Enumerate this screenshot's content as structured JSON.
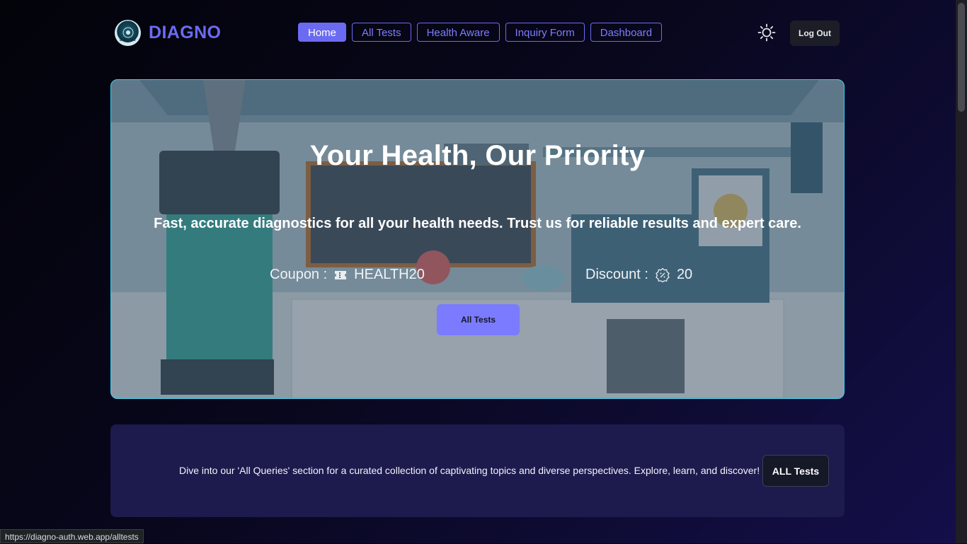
{
  "brand": {
    "name": "DIAGNO",
    "badge_text": "DIAG.NO"
  },
  "nav": {
    "items": [
      {
        "label": "Home",
        "active": true
      },
      {
        "label": "All Tests",
        "active": false
      },
      {
        "label": "Health Aware",
        "active": false
      },
      {
        "label": "Inquiry Form",
        "active": false
      },
      {
        "label": "Dashboard",
        "active": false
      }
    ]
  },
  "header": {
    "theme_icon": "sun-icon",
    "logout_label": "Log Out"
  },
  "hero": {
    "title": "Your Health, Our Priority",
    "subtitle": "Fast, accurate diagnostics for all your health needs. Trust us for reliable results and expert care.",
    "coupon_label": "Coupon :",
    "coupon_icon": "ticket-icon",
    "coupon_code": "HEALTH20",
    "discount_label": "Discount :",
    "discount_icon": "badge-percent-icon",
    "discount_value": "20",
    "button_label": "All Tests"
  },
  "banner": {
    "text": "Dive into our 'All Queries' section for a curated collection of captivating topics and diverse perspectives. Explore, learn, and discover!",
    "button_label": "ALL Tests"
  },
  "status_bar": {
    "url": "https://diagno-auth.web.app/alltests"
  },
  "colors": {
    "accent": "#6b6bf2",
    "hero_border": "#3ec9e8",
    "banner_bg": "#1d1a4d"
  }
}
